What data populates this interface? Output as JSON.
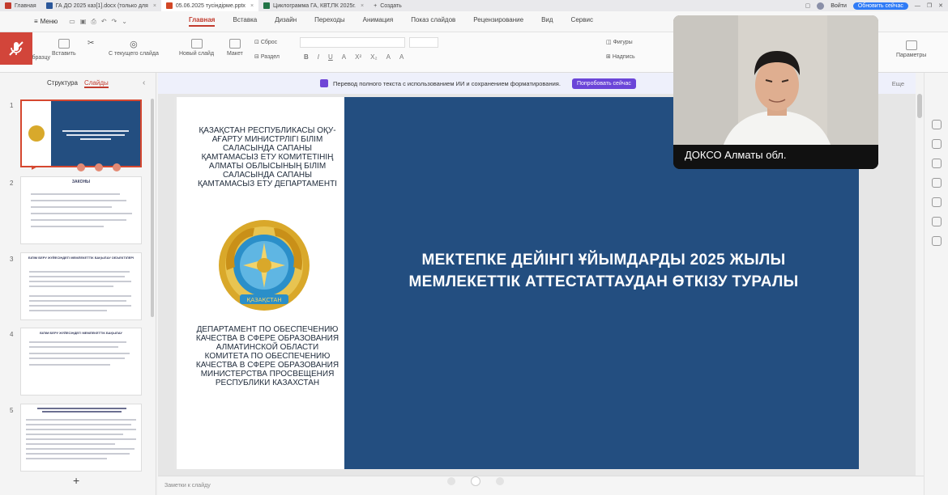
{
  "tabs": [
    {
      "label": "Главная",
      "color": "#c23b2e",
      "active": false
    },
    {
      "label": "ГА ДО 2025 каз[1].docx (только для",
      "color": "#2b579a",
      "active": false
    },
    {
      "label": "05.06.2025 тусiндiрме.pptx",
      "color": "#d24726",
      "active": true
    },
    {
      "label": "Циклограмма ГА, КВТ,ПК 2025г.",
      "color": "#217346",
      "active": false
    }
  ],
  "tab_create": "Создать",
  "header": {
    "login": "Войти",
    "update": "Обновить сейчас"
  },
  "menu": {
    "menu_label": "Меню",
    "ribbon_tabs": [
      "Главная",
      "Вставка",
      "Дизайн",
      "Переходы",
      "Анимация",
      "Показ слайдов",
      "Рецензирование",
      "Вид",
      "Сервис"
    ]
  },
  "ribbon": {
    "copy_format": "по образцу",
    "paste": "Вставить",
    "from_current": "С текущего слайда",
    "new_slide": "Новый слайд",
    "layout": "Макет",
    "reset": "Сброс",
    "section": "Раздел",
    "shapes": "Фигуры",
    "caption": "Надпись",
    "params": "Параметры"
  },
  "panel": {
    "tab_structure": "Структура",
    "tab_slides": "Слайды",
    "slide_numbers": [
      "1",
      "2",
      "3",
      "4",
      "5"
    ],
    "thumb_title_2": "ЗАКОНЫ",
    "thumb_title_3": "БІЛІМ БЕРУ ЖҮЙЕСІНДЕГІ МЕМЛЕКЕТТІК БАҚЫЛАУ ОБЪЕКТІЛЕРІ",
    "thumb_title_4": "БІЛІМ БЕРУ ЖҮЙЕСІНДЕГІ МЕМЛЕКЕТТІК БАҚЫЛАУ"
  },
  "notify": {
    "text": "Перевод полного текста с использованием ИИ и сохранением форматирования.",
    "button": "Попробовать сейчас",
    "more": "Еще"
  },
  "slide": {
    "kz_text": "ҚАЗАҚСТАН РЕСПУБЛИКАСЫ ОҚУ-АҒАРТУ МИНИСТРЛІГІ БІЛІМ САЛАСЫНДА САПАНЫ ҚАМТАМАСЫЗ ЕТУ КОМИТЕТІНІҢ АЛМАТЫ ОБЛЫСЫНЫҢ БІЛІМ САЛАСЫНДА САПАНЫ ҚАМТАМАСЫЗ ЕТУ ДЕПАРТАМЕНТІ",
    "ru_text": "ДЕПАРТАМЕНТ ПО ОБЕСПЕЧЕНИЮ КАЧЕСТВА В СФЕРЕ ОБРАЗОВАНИЯ АЛМАТИНСКОЙ ОБЛАСТИ КОМИТЕТА ПО ОБЕСПЕЧЕНИЮ КАЧЕСТВА В СФЕРЕ ОБРАЗОВАНИЯ МИНИСТЕРСТВА ПРОСВЕЩЕНИЯ РЕСПУБЛИКИ КАЗАХСТАН",
    "title": "МЕКТЕПКЕ ДЕЙІНГІ ҰЙЫМДАРДЫ 2025 ЖЫЛЫ МЕМЛЕКЕТТІК АТТЕСТАТТАУДАН ӨТКІЗУ ТУРАЛЫ",
    "panel_color": "#234e80",
    "emblem_text": "ҚАЗАҚСТАН"
  },
  "notes": {
    "placeholder": "Заметки к слайду"
  },
  "video": {
    "participant": "ДОКСО Алматы обл."
  }
}
